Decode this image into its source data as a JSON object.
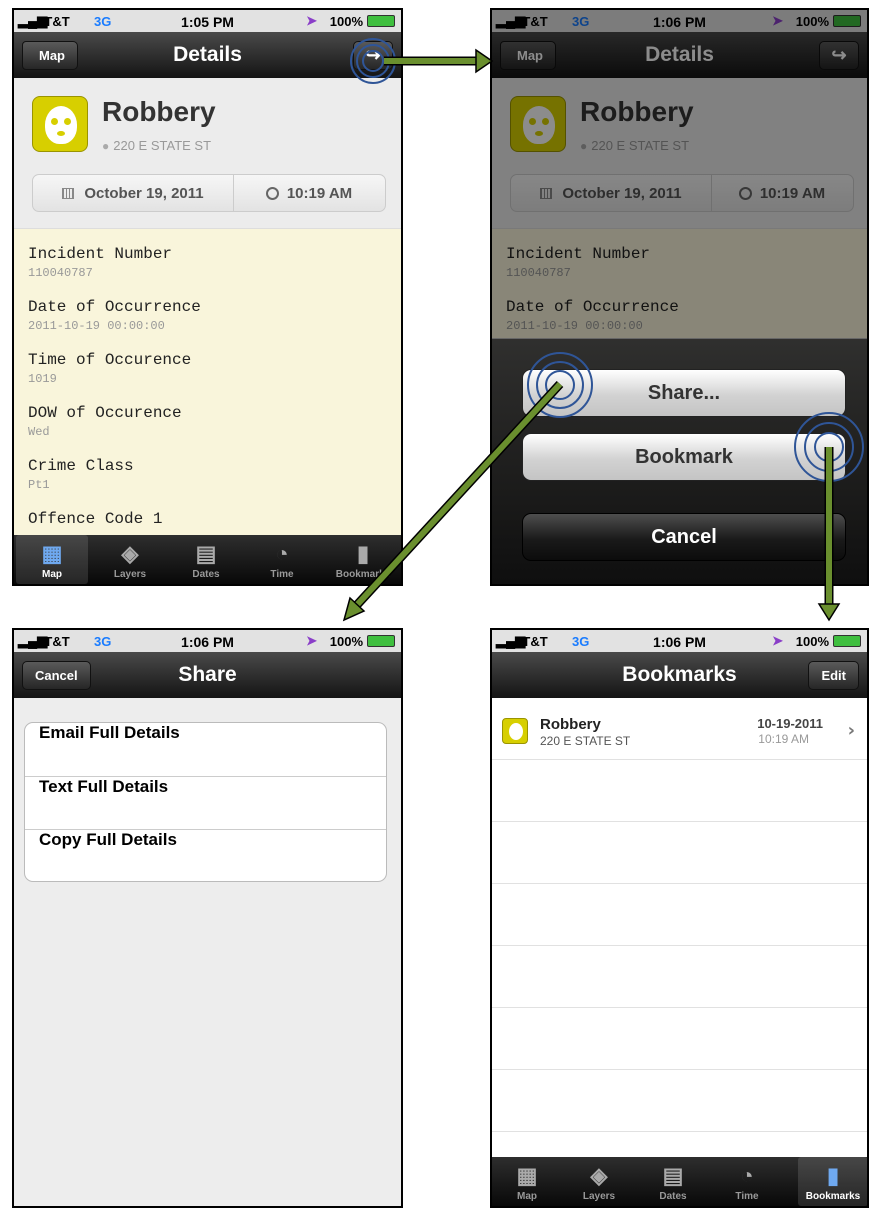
{
  "status": {
    "carrier": "AT&T",
    "network": "3G",
    "battery": "100%",
    "time_1": "1:05 PM",
    "time_2": "1:06 PM",
    "time_3": "1:06 PM",
    "time_4": "1:06 PM"
  },
  "details": {
    "title": "Details",
    "back_label": "Map",
    "share_icon": "share-arrow-icon",
    "crime_title": "Robbery",
    "address": "220 E STATE ST",
    "date": "October 19, 2011",
    "time": "10:19 AM",
    "fields": [
      {
        "label": "Incident Number",
        "value": "110040787"
      },
      {
        "label": "Date of Occurrence",
        "value": "2011-10-19 00:00:00"
      },
      {
        "label": "Time of Occurence",
        "value": "1019"
      },
      {
        "label": "DOW of Occurence",
        "value": "Wed"
      },
      {
        "label": "Crime Class",
        "value": "Pt1"
      },
      {
        "label": "Offence Code 1",
        "value": ""
      }
    ]
  },
  "tabs": [
    {
      "label": "Map",
      "icon": "map-icon"
    },
    {
      "label": "Layers",
      "icon": "layers-icon"
    },
    {
      "label": "Dates",
      "icon": "calendar-icon"
    },
    {
      "label": "Time",
      "icon": "clock-icon"
    },
    {
      "label": "Bookmarks",
      "icon": "bookmark-icon"
    }
  ],
  "action_sheet": {
    "share_label": "Share...",
    "bookmark_label": "Bookmark",
    "cancel_label": "Cancel"
  },
  "share": {
    "title": "Share",
    "cancel_label": "Cancel",
    "options": [
      "Email Full Details",
      "Text Full Details",
      "Copy Full Details"
    ]
  },
  "bookmarks": {
    "title": "Bookmarks",
    "edit_label": "Edit",
    "items": [
      {
        "title": "Robbery",
        "address": "220 E STATE ST",
        "date": "10-19-2011",
        "time": "10:19 AM"
      }
    ]
  },
  "colors": {
    "arrow": "#6a8f2e",
    "ripple": "#2f5597",
    "crime_icon": "#d7cf00",
    "active_tab": "#6fa9f0"
  }
}
